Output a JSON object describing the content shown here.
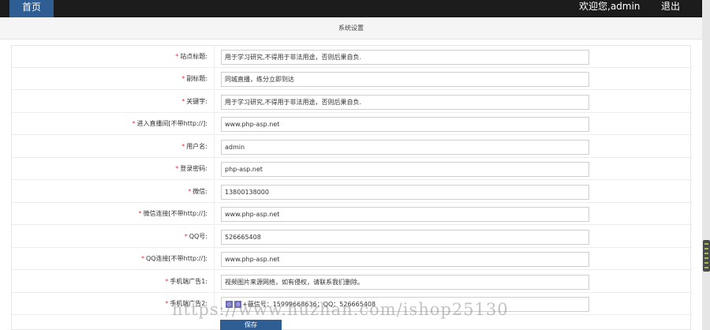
{
  "topbar": {
    "home_tab": "首页",
    "welcome": "欢迎您,admin",
    "logout": "退出"
  },
  "header": {
    "title": "系统设置"
  },
  "form": {
    "rows": [
      {
        "label": "站点标题:",
        "required": true,
        "value": "用于学习研究,不得用于非法用途，否则后果自负."
      },
      {
        "label": "副标题:",
        "required": true,
        "value": "同城直播，练分立即到达"
      },
      {
        "label": "关键字:",
        "required": true,
        "value": "用于学习研究,不得用于非法用途，否则后果自负."
      },
      {
        "label": "进入直播间[不带http://]:",
        "required": true,
        "value": "www.php-asp.net"
      },
      {
        "label": "用户名:",
        "required": true,
        "value": "admin"
      },
      {
        "label": "登录密码:",
        "required": true,
        "value": "php-asp.net"
      },
      {
        "label": "微信:",
        "required": true,
        "value": "13800138000"
      },
      {
        "label": "微信连接[不带http://]:",
        "required": true,
        "value": "www.php-asp.net"
      },
      {
        "label": "QQ号:",
        "required": true,
        "value": "526665408"
      },
      {
        "label": "QQ连接[不带http://]:",
        "required": true,
        "value": "www.php-asp.net"
      },
      {
        "label": "手机端广告1:",
        "required": true,
        "value": "视频图片来源网络，如有侵权，请联系我们删除。"
      },
      {
        "label": "手机端广告2:",
        "required": true,
        "value": "+薇信号：15999668636；QQ：526665408"
      }
    ],
    "save_label": "保存"
  },
  "watermark": "https://www.huzhan.com/ishop25130",
  "colors": {
    "topbar": "#1c1c1c",
    "home_tab": "#2f5e94",
    "required_star": "#e4393c",
    "save_button": "#2f5e94"
  }
}
